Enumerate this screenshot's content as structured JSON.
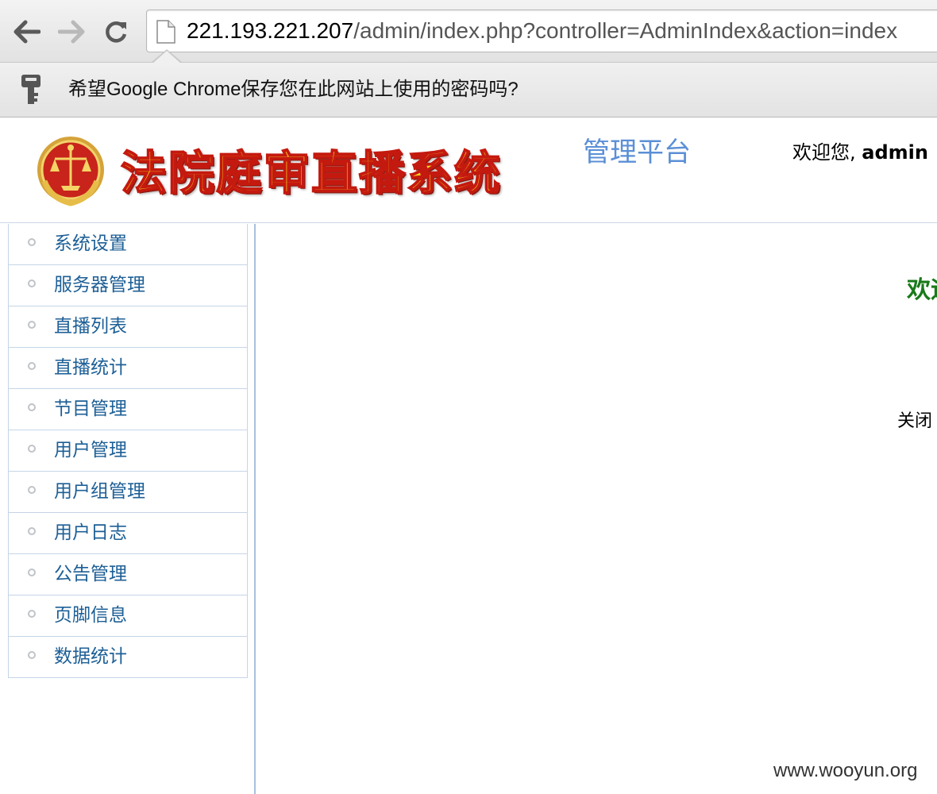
{
  "browser": {
    "back_icon": "arrow-left-icon",
    "forward_icon": "arrow-right-icon",
    "reload_icon": "reload-icon",
    "url_host": "221.193.221.207",
    "url_path": "/admin/index.php?controller=AdminIndex&action=index",
    "infobar_text": "希望Google Chrome保存您在此网站上使用的密码吗?"
  },
  "header": {
    "system_title": "法院庭审直播系统",
    "platform_label": "管理平台",
    "welcome_prefix": "欢迎您, ",
    "username": "admin"
  },
  "sidebar": {
    "items": [
      {
        "label": "系统设置"
      },
      {
        "label": "服务器管理"
      },
      {
        "label": "直播列表"
      },
      {
        "label": "直播统计"
      },
      {
        "label": "节目管理"
      },
      {
        "label": "用户管理"
      },
      {
        "label": "用户组管理"
      },
      {
        "label": "用户日志"
      },
      {
        "label": "公告管理"
      },
      {
        "label": "页脚信息"
      },
      {
        "label": "数据统计"
      }
    ]
  },
  "main": {
    "welcome_partial": "欢迎",
    "close_partial": "关闭"
  },
  "watermark": "www.wooyun.org",
  "colors": {
    "menu_link": "#1d5f96",
    "platform_label": "#5b8fd6",
    "welcome_green": "#1a7a1a",
    "title_fill": "#f6d21b",
    "title_stroke": "#c4190f"
  }
}
